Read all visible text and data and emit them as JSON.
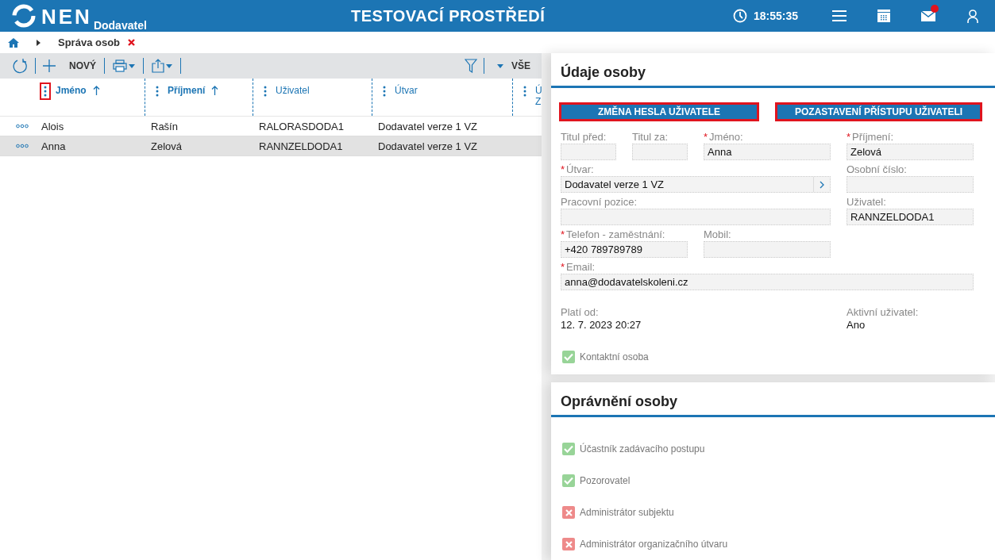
{
  "header": {
    "logo": "NEN",
    "logo_sub": "Dodavatel",
    "title": "TESTOVACÍ PROSTŘEDÍ",
    "time": "18:55:35",
    "mail_unread": true
  },
  "breadcrumb": {
    "items": [
      "Správa osob"
    ]
  },
  "toolbar": {
    "new_label": "NOVÝ",
    "filter_label": "VŠE"
  },
  "table": {
    "columns": [
      {
        "lines": [
          "Jméno"
        ],
        "sorted": true,
        "highlighted": true
      },
      {
        "lines": [
          "Příjmení"
        ],
        "sorted": true,
        "highlighted": false
      },
      {
        "lines": [
          "Uživatel"
        ],
        "sorted": false,
        "highlighted": false
      },
      {
        "lines": [
          "Útvar"
        ],
        "sorted": false,
        "highlighted": false
      },
      {
        "lines": [
          "Ú",
          "Z"
        ],
        "sorted": false,
        "highlighted": false
      }
    ],
    "rows": [
      {
        "cells": [
          "Alois",
          "Rašín",
          "RALORASDODA1",
          "Dodavatel verze 1 VZ"
        ],
        "selected": false
      },
      {
        "cells": [
          "Anna",
          "Zelová",
          "RANNZELDODA1",
          "Dodavatel verze 1 VZ"
        ],
        "selected": true
      }
    ]
  },
  "details": {
    "title": "Údaje osoby",
    "buttons": [
      {
        "label": "ZMĚNA HESLA UŽIVATELE",
        "highlighted": true
      },
      {
        "label": "POZASTAVENÍ PŘÍSTUPU UŽIVATELI",
        "highlighted": true
      }
    ],
    "fields": [
      {
        "label": "Titul před:",
        "kind": "text"
      },
      {
        "label": "Titul za:",
        "kind": "text"
      },
      {
        "marker": "*",
        "label": "Jméno:",
        "value": "Anna",
        "kind": "text"
      },
      {
        "marker": "*",
        "label": "Příjmení:",
        "value": "Zelová",
        "kind": "text"
      },
      {
        "marker": "*",
        "label": "Útvar:",
        "value": "Dodavatel verze 1 VZ",
        "kind": "lookup"
      },
      {
        "label": "Osobní číslo:",
        "kind": "text"
      },
      {
        "label": "Pracovní pozice:",
        "kind": "text"
      },
      {
        "label": "Uživatel:",
        "value": "RANNZELDODA1",
        "kind": "text"
      },
      {
        "marker": "*",
        "label": "Telefon - zaměstnání:",
        "value": "+420 789789789",
        "kind": "text"
      },
      {
        "label": "Mobil:",
        "kind": "text"
      },
      {
        "marker": "*",
        "label": "Email:",
        "value": "anna@dodavatelskoleni.cz",
        "kind": "text"
      }
    ],
    "info": [
      {
        "label": "Platí od:",
        "value": "12. 7. 2023 20:27"
      },
      {
        "label": "Aktivní uživatel:",
        "value": "Ano"
      }
    ],
    "contact": {
      "label": "Kontaktní osoba",
      "checked": true
    }
  },
  "permissions": {
    "title": "Oprávnění osoby",
    "items": [
      {
        "label": "Účastník zadávacího postupu",
        "granted": true
      },
      {
        "label": "Pozorovatel",
        "granted": true
      },
      {
        "label": "Administrátor subjektu",
        "granted": false
      },
      {
        "label": "Administrátor organizačního útvaru",
        "granted": false
      }
    ]
  }
}
